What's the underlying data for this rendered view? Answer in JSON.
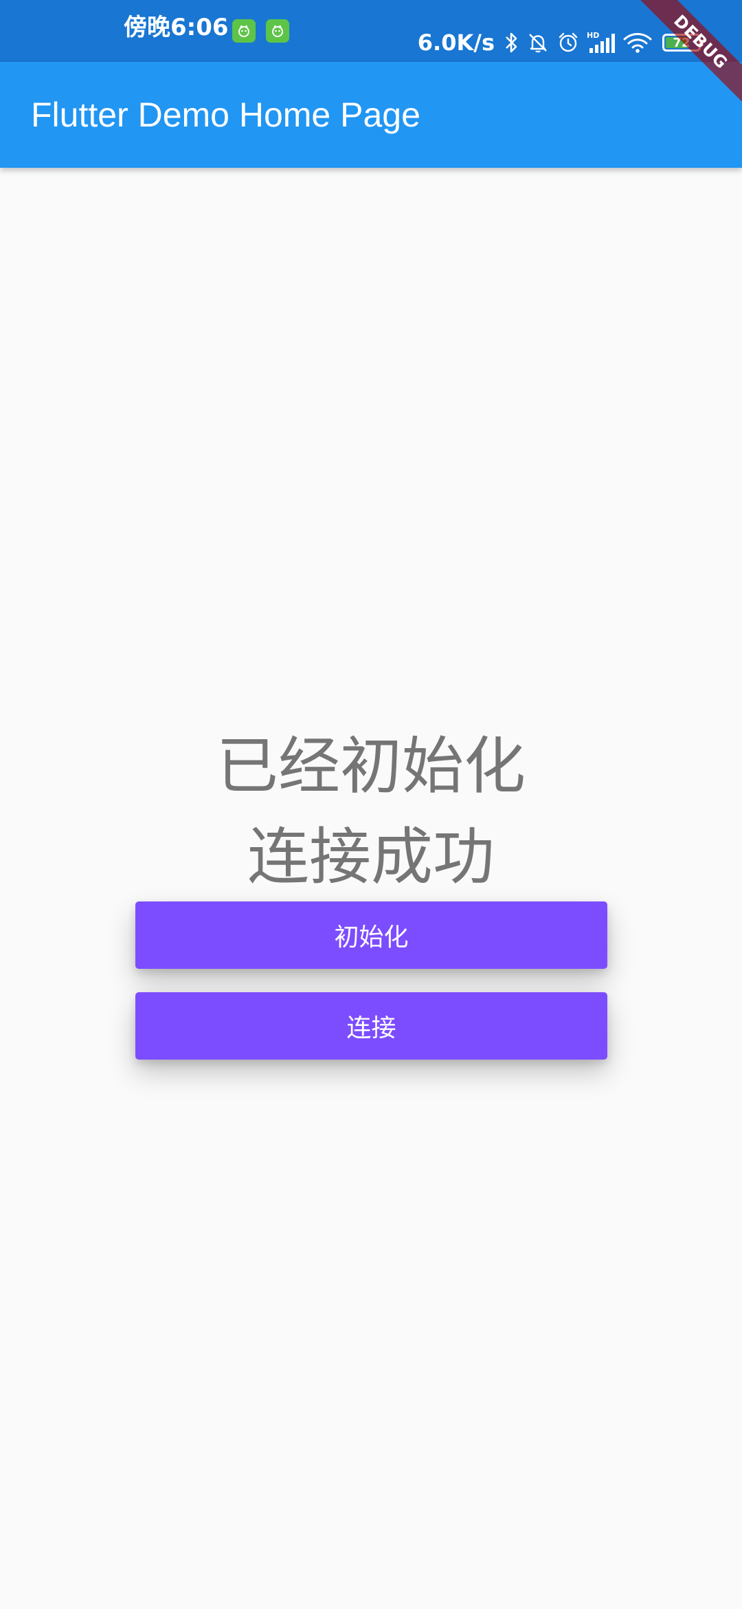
{
  "status_bar": {
    "time": "傍晚6:06",
    "net_speed": "6.0K/s",
    "battery_level": "72",
    "battery_fraction": 0.72,
    "icons": [
      "app-badge-icon",
      "app-badge-icon",
      "bluetooth-icon",
      "bell-off-icon",
      "alarm-icon",
      "hd-signal-icon",
      "wifi-icon",
      "battery-icon"
    ]
  },
  "app_bar": {
    "title": "Flutter Demo Home Page"
  },
  "debug_banner": {
    "label": "DEBUG"
  },
  "main": {
    "init_status": "已经初始化",
    "connect_status": "连接成功",
    "init_button_label": "初始化",
    "connect_button_label": "连接"
  },
  "colors": {
    "status_bar": "#1976D2",
    "app_bar": "#2196F3",
    "button": "#7C4DFF",
    "background": "#FAFAFA",
    "status_text": "#757575"
  }
}
